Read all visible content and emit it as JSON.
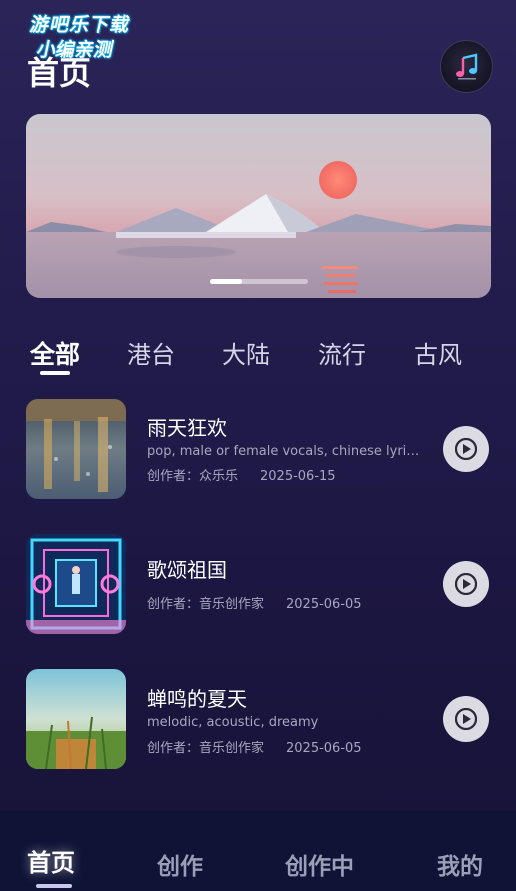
{
  "watermark": {
    "line1": "游吧乐下载",
    "line2": "小编亲测"
  },
  "header": {
    "title": "首页",
    "avatar_icon": "music-note-avatar-icon"
  },
  "banner": {
    "slides": 3,
    "active_slide": 1
  },
  "tabs": [
    {
      "label": "全部",
      "active": true
    },
    {
      "label": "港台",
      "active": false
    },
    {
      "label": "大陆",
      "active": false
    },
    {
      "label": "流行",
      "active": false
    },
    {
      "label": "古风",
      "active": false
    }
  ],
  "songs": [
    {
      "title": "雨天狂欢",
      "tags": "pop, male or female vocals, chinese lyrics,...",
      "author": "创作者：众乐乐",
      "date": "2025-06-15"
    },
    {
      "title": "歌颂祖国",
      "tags": "",
      "author": "创作者：音乐创作家",
      "date": "2025-06-05"
    },
    {
      "title": "蝉鸣的夏天",
      "tags": "melodic, acoustic, dreamy",
      "author": "创作者：音乐创作家",
      "date": "2025-06-05"
    }
  ],
  "bottom_nav": [
    {
      "label": "首页",
      "active": true
    },
    {
      "label": "创作",
      "active": false
    },
    {
      "label": "创作中",
      "active": false
    },
    {
      "label": "我的",
      "active": false
    }
  ],
  "colors": {
    "background": "#221c4c",
    "nav_background": "#0f1436",
    "play_button": "#dcdbe3",
    "muted_text": "#a9a6c0"
  }
}
